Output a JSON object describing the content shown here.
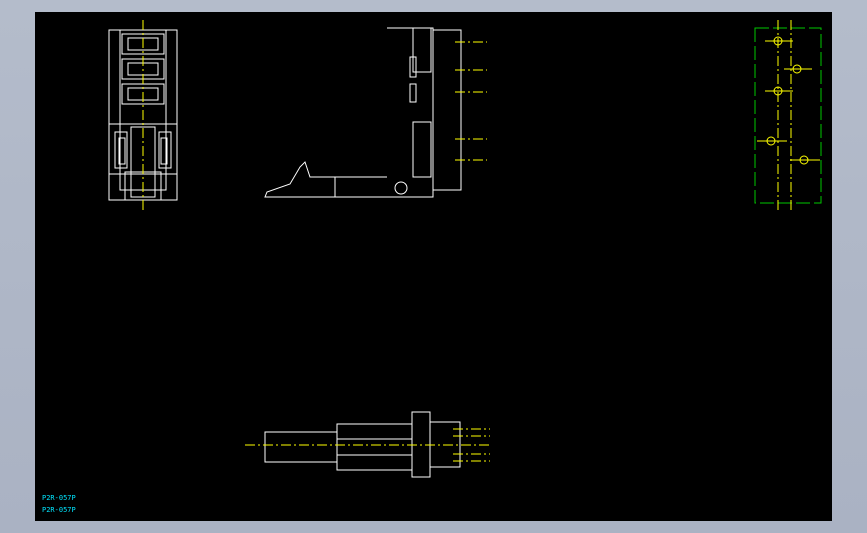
{
  "drawing": {
    "label_line1": "P2R-057P",
    "label_line2": "P2R-057P"
  },
  "colors": {
    "frame_bg": "#aab2c3",
    "canvas_bg": "#000000",
    "outline": "#ffffff",
    "centerline": "#ffff00",
    "pcb_layout": "#00c800",
    "label": "#00e5ff"
  }
}
